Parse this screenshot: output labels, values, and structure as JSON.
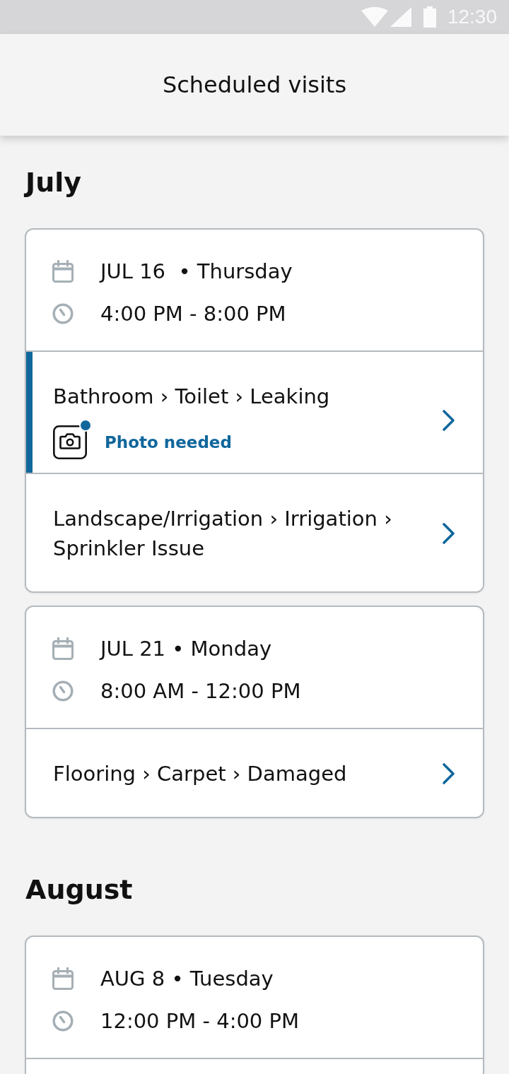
{
  "status_bar": {
    "time": "12:30"
  },
  "header": {
    "title": "Scheduled visits"
  },
  "sections": [
    {
      "month": "July",
      "visits": [
        {
          "date": "JUL 16  • Thursday",
          "time": "4:00 PM - 8:00 PM",
          "issues": [
            {
              "path": "Bathroom › Toilet › Leaking",
              "highlighted": true,
              "photo": {
                "label": "Photo needed",
                "alert": true
              }
            },
            {
              "path": "Landscape/Irrigation › Irrigation › Sprinkler Issue",
              "highlighted": false
            }
          ]
        },
        {
          "date": "JUL 21 • Monday",
          "time": "8:00 AM - 12:00 PM",
          "issues": [
            {
              "path": "Flooring › Carpet › Damaged",
              "highlighted": false
            }
          ]
        }
      ]
    },
    {
      "month": "August",
      "visits": [
        {
          "date": "AUG 8 • Tuesday",
          "time": "12:00 PM - 4:00 PM"
        }
      ]
    }
  ]
}
